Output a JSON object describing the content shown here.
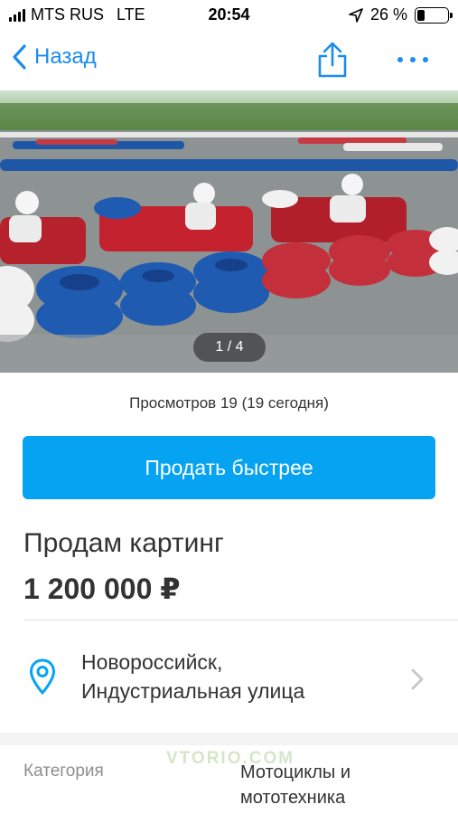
{
  "status_bar": {
    "carrier": "MTS RUS",
    "network": "LTE",
    "time": "20:54",
    "battery_percent": "26 %",
    "battery_level": 0.26
  },
  "nav": {
    "back_label": "Назад",
    "accent_color": "#1a8cf0"
  },
  "gallery": {
    "counter": "1 / 4",
    "current": 1,
    "total": 4
  },
  "listing": {
    "views": "Просмотров 19 (19 сегодня)",
    "sell_button": "Продать быстрее",
    "title": "Продам картинг",
    "price": "1 200 000 ₽",
    "location_line1": "Новороссийск,",
    "location_line2": "Индустриальная улица",
    "category_label": "Категория",
    "category_value_line1": "Мотоциклы и",
    "category_value_line2": "мототехника"
  },
  "watermark": "VTORIO.COM",
  "colors": {
    "primary_button": "#06a3f3",
    "text": "#333333",
    "muted": "#8e8e8e"
  },
  "icons": {
    "back": "chevron-left-icon",
    "share": "share-icon",
    "more": "more-dots-icon",
    "location": "location-pin-icon",
    "disclosure": "chevron-right-icon"
  }
}
